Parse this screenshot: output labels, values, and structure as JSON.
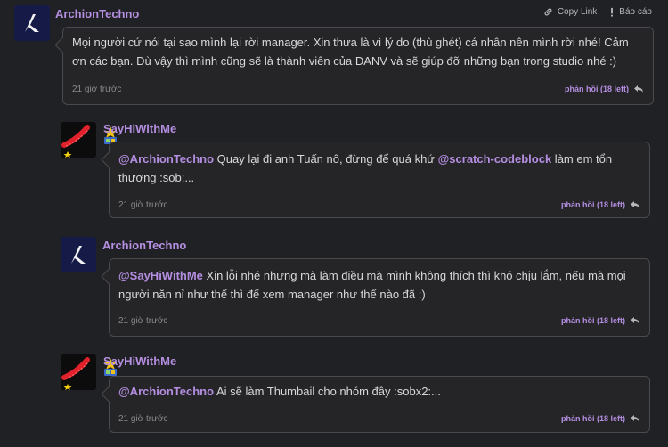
{
  "top_actions": {
    "copy_link": "Copy Link",
    "report": "Báo cáo"
  },
  "comments": [
    {
      "author": "ArchionTechno",
      "text": "Mọi người cứ nói tại sao mình lại rời manager. Xin thưa là vì lý do (thù ghét) cá nhân nên mình rời nhé! Cảm ơn các bạn. Dù vậy thì mình cũng sẽ là thành viên của DANV và sẽ giúp đỡ những bạn trong studio nhé :)",
      "time": "21 giờ trước",
      "reply": "phản hồi (18 left)"
    },
    {
      "author": "SayHiWithMe",
      "mention1": "@ArchionTechno",
      "text1": " Quay lại đi anh Tuấn nô, đừng để quá khứ ",
      "mention2": "@scratch-codeblock",
      "text2": " làm em tổn thương :sob:...",
      "time": "21 giờ trước",
      "reply": "phản hồi (18 left)"
    },
    {
      "author": "ArchionTechno",
      "mention1": "@SayHiWithMe",
      "text1": " Xin lỗi nhé nhưng mà làm điều mà mình không thích thì khó chịu lắm, nếu mà mọi người năn nỉ như thế thì để xem manager như thế nào đã :)",
      "time": "21 giờ trước",
      "reply": "phản hồi (18 left)"
    },
    {
      "author": "SayHiWithMe",
      "mention1": "@ArchionTechno",
      "text1": " Ai sẽ làm Thumbail cho nhóm đây :sobx2:...",
      "time": "21 giờ trước",
      "reply": "phản hồi (18 left)"
    }
  ],
  "colors": {
    "accent": "#b48ee0",
    "background": "#202124",
    "bubble": "#252528",
    "border": "#4a4a4e"
  }
}
